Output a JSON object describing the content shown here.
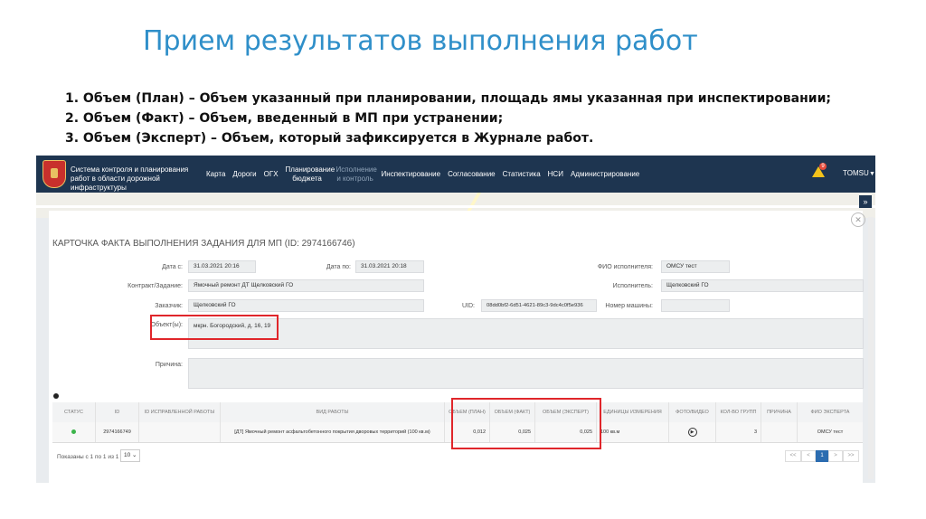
{
  "slide": {
    "title": "Прием результатов выполнения работ",
    "notes": [
      "1. Объем (План) – Объем указанный при планировании, площадь ямы указанная при инспектировании;",
      "2. Объем (Факт) – Объем, введенный в МП при устранении;",
      "3. Объем (Эксперт) – Объем, который зафиксируется в Журнале работ."
    ]
  },
  "app": {
    "system_name": "Система контроля и планирования работ в области дорожной инфраструктуры",
    "nav": [
      {
        "label": "Карта"
      },
      {
        "label": "Дороги"
      },
      {
        "label": "ОГХ"
      },
      {
        "label": "Планирование бюджета"
      },
      {
        "label": "Исполнение и контроль"
      },
      {
        "label": "Инспектирование"
      },
      {
        "label": "Согласование"
      },
      {
        "label": "Статистика"
      },
      {
        "label": "НСИ"
      },
      {
        "label": "Администрирование"
      }
    ],
    "alerts_count": "9",
    "user": "TOMSU",
    "sidebar_toggle": "»",
    "close": "✕"
  },
  "card": {
    "title": "КАРТОЧКА ФАКТА ВЫПОЛНЕНИЯ ЗАДАНИЯ ДЛЯ МП (ID: 2974166746)",
    "date_from_label": "Дата с:",
    "date_from": "31.03.2021 20:16",
    "date_to_label": "Дата по:",
    "date_to": "31.03.2021 20:18",
    "executor_name_label": "ФИО исполнителя:",
    "executor_name": "ОМСУ тест",
    "contract_label": "Контракт/Задание:",
    "contract": "Ямочный ремонт ДТ Щелковский ГО",
    "executor_label": "Исполнитель:",
    "executor": "Щелковский ГО",
    "customer_label": "Заказчик:",
    "customer": "Щелковский ГО",
    "uid_label": "UID:",
    "uid": "08dd0bf2-6d51-4621-89c3-9dc4c0f5e936",
    "car_number_label": "Номер машины:",
    "car_number": "",
    "objects_label": "Объект(ы):",
    "objects": "мкрн. Богородский, д. 16, 19",
    "reason_label": "Причина:",
    "reason": ""
  },
  "table": {
    "columns": [
      "СТАТУС",
      "ID",
      "ID ИСПРАВЛЕННОЙ РАБОТЫ",
      "ВИД РАБОТЫ",
      "ОБЪЕМ (ПЛАН)",
      "ОБЪЕМ (ФАКТ)",
      "ОБЪЕМ (ЭКСПЕРТ)",
      "ЕДИНИЦЫ ИЗМЕРЕНИЯ",
      "ФОТО/ВИДЕО",
      "КОЛ-ВО ГРУПП",
      "ПРИЧИНА",
      "ФИО ЭКСПЕРТА"
    ],
    "rows": [
      {
        "status": "active",
        "id": "2974166749",
        "fixed_id": "",
        "work_type": "[ДТ] Ямочный ремонт асфальтобетонного покрытия дворовых территорий (100 кв.м)",
        "plan": "0,012",
        "fact": "0,025",
        "expert": "0,025",
        "unit": "100 кв.м",
        "media": "▶",
        "groups": "3",
        "reason": "",
        "expert_name": "ОМСУ тест"
      }
    ],
    "footer": "Показаны с 1 по 1 из 1",
    "page_size": "10",
    "pager": [
      "<<",
      "<",
      "1",
      ">",
      ">>"
    ]
  },
  "colors": {
    "title_blue": "#2f8fc9",
    "topbar": "#1e3550",
    "highlight_red": "#e0262b",
    "status_green": "#3cb44b"
  }
}
